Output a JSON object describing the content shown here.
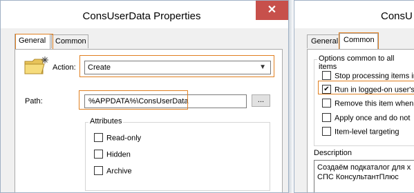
{
  "window1": {
    "title": "ConsUserData Properties",
    "close": "✕",
    "tabs": [
      "General",
      "Common"
    ],
    "action_label": "Action:",
    "action_value": "Create",
    "path_label": "Path:",
    "path_value": "%APPDATA%\\ConsUserData",
    "browse_label": "...",
    "attributes": {
      "title": "Attributes",
      "items": [
        "Read-only",
        "Hidden",
        "Archive"
      ]
    }
  },
  "window2": {
    "title": "ConsU",
    "tabs": [
      "General",
      "Common"
    ],
    "options_title": "Options common to all items",
    "options": [
      {
        "label": "Stop processing items in",
        "checked": false
      },
      {
        "label": "Run in logged-on user's",
        "checked": true
      },
      {
        "label": "Remove this item when",
        "checked": false
      },
      {
        "label": "Apply once and do not",
        "checked": false
      },
      {
        "label": "Item-level targeting",
        "checked": false
      }
    ],
    "description_label": "Description",
    "description_lines": [
      "Создаём подкаталог для х",
      "СПС КонсультантПлюс"
    ]
  },
  "colors": {
    "highlight": "#e07f1f",
    "close": "#c7504b"
  },
  "icons": {
    "folder": "folder-new-icon",
    "check": "checkmark-icon"
  }
}
